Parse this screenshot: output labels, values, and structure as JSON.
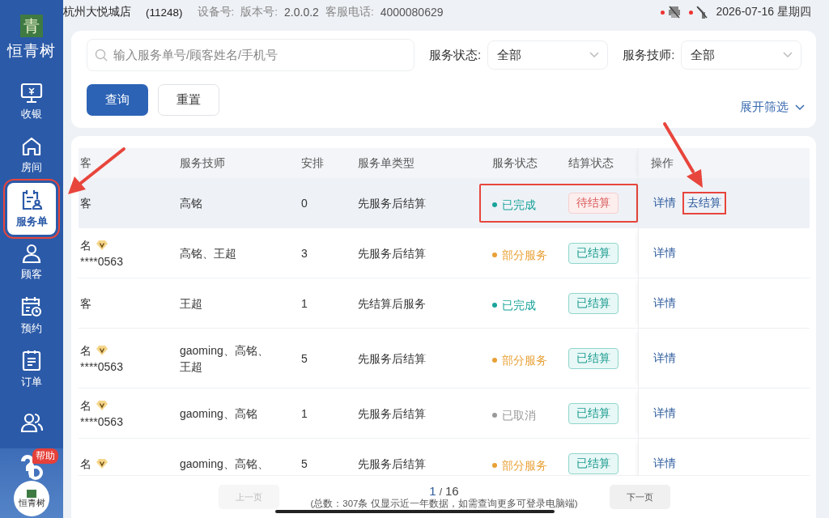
{
  "top_bar": {
    "store": "杭州大悦城店",
    "store_code": "(11248)",
    "device_label": "设备号:",
    "version_label": "版本号:",
    "version": "2.0.0.2",
    "phone_label": "客服电话:",
    "phone": "4000080629",
    "date": "2026-07-16 星期四",
    "printer_offline": true,
    "network_offline": true
  },
  "sidebar": {
    "logo_char": "青",
    "brand": "恒青树",
    "items": [
      {
        "label": "收银",
        "selected": false,
        "annotated": false
      },
      {
        "label": "房间",
        "selected": false,
        "annotated": false
      },
      {
        "label": "服务单",
        "selected": true,
        "annotated": true
      },
      {
        "label": "顾客",
        "selected": false,
        "annotated": false
      },
      {
        "label": "预约",
        "selected": false,
        "annotated": false
      },
      {
        "label": "订单",
        "selected": false,
        "annotated": false
      },
      {
        "selected": false,
        "annotated": false
      }
    ],
    "help_badge": "帮助",
    "avatar_text": "恒青树"
  },
  "filters": {
    "search": {
      "placeholder": "输入服务单号/顾客姓名/手机号"
    },
    "selects": [
      {
        "label": "服务状态:",
        "value": "全部"
      },
      {
        "label": "服务技师:",
        "value": "全部"
      }
    ],
    "buttons": [
      {
        "label": "查询",
        "kind": "primary"
      },
      {
        "label": "重置",
        "kind": "default"
      }
    ],
    "expand": "展开筛选"
  },
  "table": {
    "columns": [
      "客",
      "服务技师",
      "安排",
      "服务单类型",
      "服务状态",
      "结算状态",
      "操作"
    ],
    "rows": [
      {
        "customer": "客",
        "vip": false,
        "technician": "高铭",
        "arranged": "0",
        "type": "先服务后结算",
        "status": "已完成",
        "color": "#1aa39a",
        "settlement": "待结算",
        "settled": false,
        "annotated": true,
        "selected": true,
        "actions": [
          {
            "label": "详情",
            "annotated": false
          },
          {
            "label": "去结算",
            "annotated": true
          }
        ]
      },
      {
        "customer": "名",
        "vip": true,
        "phone": "****0563",
        "technician": "高铭、王超",
        "arranged": "3",
        "type": "先服务后结算",
        "status": "部分服务",
        "color": "#e8a035",
        "settlement": "已结算",
        "settled": true,
        "annotated": false,
        "selected": false,
        "actions": [
          {
            "label": "详情",
            "annotated": false
          }
        ]
      },
      {
        "customer": "客",
        "vip": false,
        "technician": "王超",
        "arranged": "1",
        "type": "先结算后服务",
        "status": "已完成",
        "color": "#1aa39a",
        "settlement": "已结算",
        "settled": true,
        "annotated": false,
        "selected": false,
        "actions": [
          {
            "label": "详情",
            "annotated": false
          }
        ]
      },
      {
        "customer": "名",
        "vip": true,
        "phone": "****0563",
        "technician": "gaoming、高铭、王超",
        "arranged": "5",
        "type": "先服务后结算",
        "status": "部分服务",
        "color": "#e8a035",
        "settlement": "已结算",
        "settled": true,
        "annotated": false,
        "selected": false,
        "actions": [
          {
            "label": "详情",
            "annotated": false
          }
        ]
      },
      {
        "customer": "名",
        "vip": true,
        "phone": "****0563",
        "technician": "gaoming、高铭",
        "arranged": "1",
        "type": "先服务后结算",
        "status": "已取消",
        "color": "#999999",
        "settlement": "已结算",
        "settled": true,
        "annotated": false,
        "selected": false,
        "actions": [
          {
            "label": "详情",
            "annotated": false
          }
        ]
      },
      {
        "customer": "名",
        "vip": true,
        "technician": "gaoming、高铭、",
        "arranged": "5",
        "type": "先服务后结算",
        "status": "部分服务",
        "color": "#e8a035",
        "settlement": "已结算",
        "settled": true,
        "annotated": false,
        "selected": false,
        "actions": [
          {
            "label": "详情",
            "annotated": false
          }
        ]
      }
    ]
  },
  "pagination": {
    "prev": {
      "label": "上一页",
      "disabled": true
    },
    "current": "1",
    "separator": "/",
    "total_pages": "16",
    "note": "(总数：307条 仅显示近一年数据，如需查询更多可登录电脑端)",
    "next": {
      "label": "下一页",
      "disabled": false
    }
  }
}
